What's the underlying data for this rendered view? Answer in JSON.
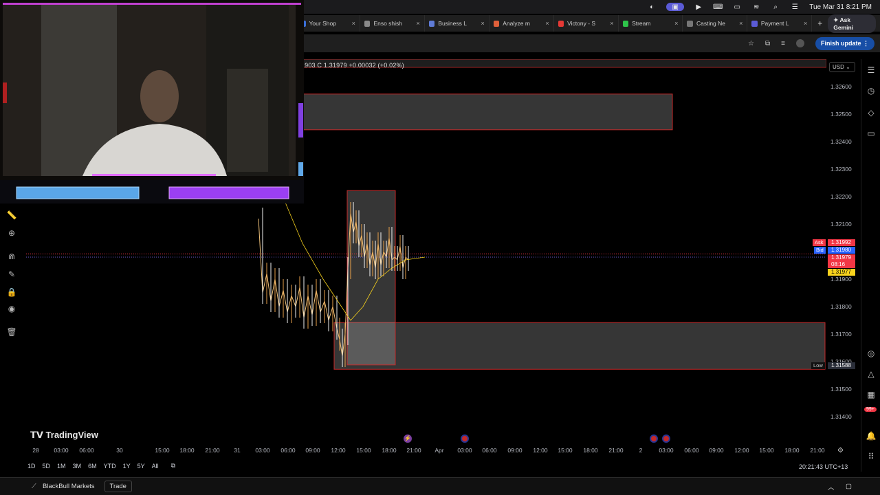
{
  "menubar": {
    "datetime": "Tue Mar 31  8:21 PM"
  },
  "tabs": [
    {
      "label": "Your Shop",
      "color": "#3b6fd8"
    },
    {
      "label": "Enso shish",
      "color": "#888888"
    },
    {
      "label": "Business L",
      "color": "#5f7bd6"
    },
    {
      "label": "Analyze m",
      "color": "#e0603a"
    },
    {
      "label": "Victony - S",
      "color": "#e53935"
    },
    {
      "label": "Stream",
      "color": "#2ec44a"
    },
    {
      "label": "Casting Ne",
      "color": "#777777"
    },
    {
      "label": "Payment L",
      "color": "#5b5bd6"
    }
  ],
  "browser": {
    "new_tab": "+",
    "ask_gemini": "Ask Gemini",
    "finish_update": "Finish update"
  },
  "legend": {
    "text": ".31903  C 1.31979  +0.00032 (+0.02%)"
  },
  "price_axis": {
    "currency": "USD",
    "ticks": [
      "1.32600",
      "1.32500",
      "1.32400",
      "1.32300",
      "1.32200",
      "1.32100",
      "1.31900",
      "1.31800",
      "1.31700",
      "1.31600",
      "1.31500",
      "1.31400"
    ],
    "ask_label": "Ask",
    "ask_price": "1.31992",
    "bid_label": "Bid",
    "bid_price": "1.31980",
    "last_price": "1.31979",
    "countdown": "08:16",
    "vwap_price": "1.31977",
    "low_label": "Low",
    "low_price": "1.31588",
    "colors": {
      "ask": "#f23645",
      "bid": "#2962ff",
      "last": "#f23645",
      "vwap": "#f7d21d"
    }
  },
  "time_axis": {
    "ticks": [
      "28",
      "03:00",
      "06:00",
      "30",
      "15:00",
      "18:00",
      "21:00",
      "31",
      "03:00",
      "06:00",
      "09:00",
      "12:00",
      "15:00",
      "18:00",
      "21:00",
      "Apr",
      "03:00",
      "06:00",
      "09:00",
      "12:00",
      "15:00",
      "18:00",
      "21:00",
      "2",
      "03:00",
      "06:00",
      "09:00",
      "12:00",
      "15:00",
      "18:00",
      "21:00"
    ]
  },
  "branding": {
    "tradingview": "TradingView"
  },
  "ranges": [
    "1D",
    "5D",
    "1M",
    "3M",
    "6M",
    "YTD",
    "1Y",
    "5Y",
    "All"
  ],
  "clock": "20:21:43 UTC+13",
  "footer": {
    "broker": "BlackBull Markets",
    "trade": "Trade"
  },
  "left_tools": [
    "ruler-icon",
    "zoom-in-icon",
    "magnet-icon",
    "pencil-lock-icon",
    "lock-icon",
    "eye-icon",
    "trash-icon"
  ],
  "right_tools": [
    "watchlist-icon",
    "alerts-clock-icon",
    "layers-icon",
    "chat-icon",
    "target-icon",
    "triangle-icon",
    "calendar-icon",
    "bell-icon",
    "grid-icon"
  ],
  "notifications_badge": "99+",
  "chart_data": {
    "type": "candlestick",
    "symbol_last": {
      "close": 1.31979,
      "change": 0.00032,
      "change_pct": 0.02
    },
    "ylim": [
      1.3135,
      1.3272
    ],
    "zones": [
      {
        "name": "supply-zone",
        "x_from": "31 12:00",
        "x_to": "Apr 21:00",
        "y_from": 1.32443,
        "y_to": 1.32573
      },
      {
        "name": "demand-zone",
        "x_from": "31 12:00",
        "x_to": "2 21:00",
        "y_from": 1.31572,
        "y_to": 1.31742
      },
      {
        "name": "session-box",
        "x_from": "31 12:00",
        "x_to": "31 20:00",
        "y_from": 1.31588,
        "y_to": 1.32222
      }
    ],
    "horizontal_lines": [
      {
        "name": "ask-line",
        "y": 1.31992
      },
      {
        "name": "bid-line",
        "y": 1.3198
      }
    ],
    "note_series": "intraday price path values estimated from axis",
    "path_points": [
      [
        0,
        1.3212
      ],
      [
        6,
        1.3185
      ],
      [
        12,
        1.3192
      ],
      [
        18,
        1.3182
      ],
      [
        24,
        1.319
      ],
      [
        30,
        1.318
      ],
      [
        36,
        1.3186
      ],
      [
        42,
        1.3178
      ],
      [
        48,
        1.3184
      ],
      [
        54,
        1.318
      ],
      [
        60,
        1.3187
      ],
      [
        66,
        1.3176
      ],
      [
        72,
        1.3184
      ],
      [
        78,
        1.3177
      ],
      [
        84,
        1.3186
      ],
      [
        90,
        1.3178
      ],
      [
        96,
        1.3182
      ],
      [
        102,
        1.3175
      ],
      [
        108,
        1.318
      ],
      [
        114,
        1.3172
      ],
      [
        118,
        1.3168
      ],
      [
        122,
        1.3162
      ],
      [
        126,
        1.317
      ],
      [
        130,
        1.3194
      ],
      [
        134,
        1.3214
      ],
      [
        138,
        1.3207
      ],
      [
        142,
        1.3211
      ],
      [
        146,
        1.3202
      ],
      [
        150,
        1.3206
      ],
      [
        154,
        1.3198
      ],
      [
        158,
        1.3203
      ],
      [
        162,
        1.3195
      ],
      [
        166,
        1.32
      ],
      [
        170,
        1.3194
      ],
      [
        174,
        1.3203
      ],
      [
        178,
        1.3195
      ],
      [
        182,
        1.32
      ],
      [
        186,
        1.3198
      ],
      [
        190,
        1.3205
      ],
      [
        194,
        1.3197
      ],
      [
        198,
        1.3198
      ],
      [
        202,
        1.3197
      ],
      [
        206,
        1.3202
      ],
      [
        210,
        1.3194
      ],
      [
        214,
        1.3198
      ],
      [
        218,
        1.3197
      ]
    ],
    "vwap_points": [
      [
        8,
        1.3222
      ],
      [
        40,
        1.3203
      ],
      [
        70,
        1.319
      ],
      [
        110,
        1.3175
      ],
      [
        128,
        1.318
      ],
      [
        150,
        1.319
      ],
      [
        170,
        1.3194
      ],
      [
        190,
        1.3197
      ],
      [
        218,
        1.3198
      ]
    ]
  }
}
